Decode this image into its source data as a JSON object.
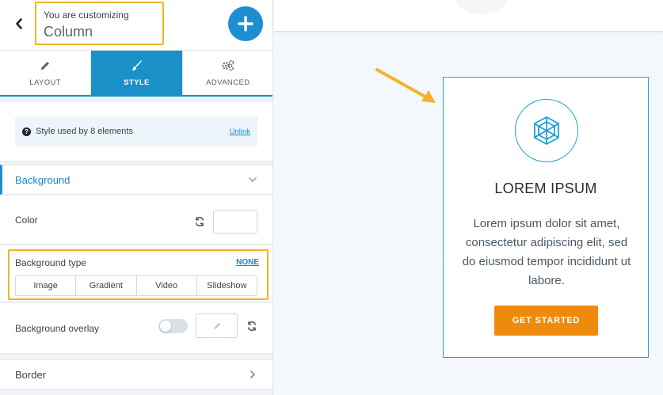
{
  "header": {
    "customizing_label": "You are customizing",
    "element_name": "Column",
    "back_icon": "chevron-left-icon",
    "add_icon": "plus-icon",
    "add_button_color": "#1d8fd0",
    "highlight_color": "#f0b429"
  },
  "tabs": [
    {
      "label": "LAYOUT",
      "icon": "pencil-icon",
      "active": false
    },
    {
      "label": "STYLE",
      "icon": "brush-icon",
      "active": true
    },
    {
      "label": "ADVANCED",
      "icon": "gears-icon",
      "active": false
    }
  ],
  "style_info": {
    "text": "Style used by 8 elements",
    "unlink_label": "Unlink"
  },
  "background": {
    "title": "Background",
    "expanded": true,
    "color_label": "Color",
    "type_label": "Background type",
    "type_value": "NONE",
    "type_options": [
      "Image",
      "Gradient",
      "Video",
      "Slideshow"
    ],
    "overlay_label": "Background overlay",
    "overlay_enabled": false
  },
  "border": {
    "title": "Border"
  },
  "preview": {
    "card_title": "LOREM IPSUM",
    "card_text": "Lorem ipsum dolor sit amet, consectetur adipiscing elit, sed do eiusmod tempor incididunt ut labore.",
    "cta_label": "GET STARTED",
    "cta_color": "#f08a0c",
    "accent_color": "#1aa0d8",
    "icon": "geodesic-sphere-icon"
  }
}
